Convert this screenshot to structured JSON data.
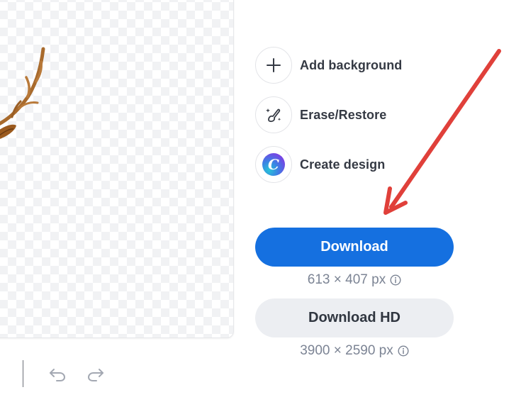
{
  "preview": {
    "image_alt": "deer with antlers, background removed"
  },
  "history": {
    "undo_icon": "undo-icon",
    "redo_icon": "redo-icon"
  },
  "options": [
    {
      "label": "Add background",
      "icon": "plus-icon"
    },
    {
      "label": "Erase/Restore",
      "icon": "magic-brush-icon"
    },
    {
      "label": "Create design",
      "icon": "canva-logo-icon",
      "logo_letter": "C"
    }
  ],
  "download": {
    "label": "Download",
    "dimensions": "613 × 407 px"
  },
  "download_hd": {
    "label": "Download HD",
    "dimensions": "3900 × 2590 px"
  },
  "colors": {
    "primary": "#1570e0",
    "secondary_button": "#eceef2",
    "annotation_arrow": "#e0403a",
    "muted_text": "#7c8494"
  }
}
